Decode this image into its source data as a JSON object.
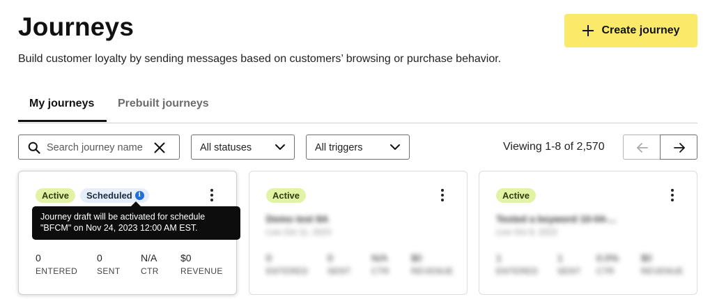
{
  "header": {
    "title": "Journeys",
    "subtitle": "Build customer loyalty by sending messages based on customers’ browsing or purchase behavior.",
    "create_label": "Create journey"
  },
  "tabs": [
    {
      "label": "My journeys",
      "active": true
    },
    {
      "label": "Prebuilt journeys",
      "active": false
    }
  ],
  "filters": {
    "search_placeholder": "Search journey name",
    "status_label": "All statuses",
    "trigger_label": "All triggers"
  },
  "pagination": {
    "viewing_text": "Viewing 1-8 of 2,570"
  },
  "colors": {
    "accent": "#fbea6a",
    "active_badge": "#e2f3a6",
    "scheduled_badge": "#e6eefb",
    "info": "#1f6fdc"
  },
  "tooltip": {
    "line1": "Journey draft will be activated for schedule",
    "line2": "\"BFCM\" on Nov 24, 2023 12:00 AM EST."
  },
  "cards": [
    {
      "status": "Active",
      "scheduled": "Scheduled",
      "name": "",
      "date": "",
      "stats": [
        {
          "value": "0",
          "label": "ENTERED"
        },
        {
          "value": "0",
          "label": "SENT"
        },
        {
          "value": "N/A",
          "label": "CTR"
        },
        {
          "value": "$0",
          "label": "REVENUE"
        }
      ]
    },
    {
      "status": "Active",
      "name": "Demo test 8A",
      "date": "Live Oct 11, 2023",
      "stats": [
        {
          "value": "0",
          "label": "ENTERED"
        },
        {
          "value": "0",
          "label": "SENT"
        },
        {
          "value": "N/A",
          "label": "CTR"
        },
        {
          "value": "$0",
          "label": "REVENUE"
        }
      ]
    },
    {
      "status": "Active",
      "name": "Texted a keyword 10-04-...",
      "date": "Live Oct 9, 2023",
      "stats": [
        {
          "value": "1",
          "label": "ENTERED"
        },
        {
          "value": "1",
          "label": "SENT"
        },
        {
          "value": "0.0%",
          "label": "CTR"
        },
        {
          "value": "$0",
          "label": "REVENUE"
        }
      ]
    }
  ]
}
